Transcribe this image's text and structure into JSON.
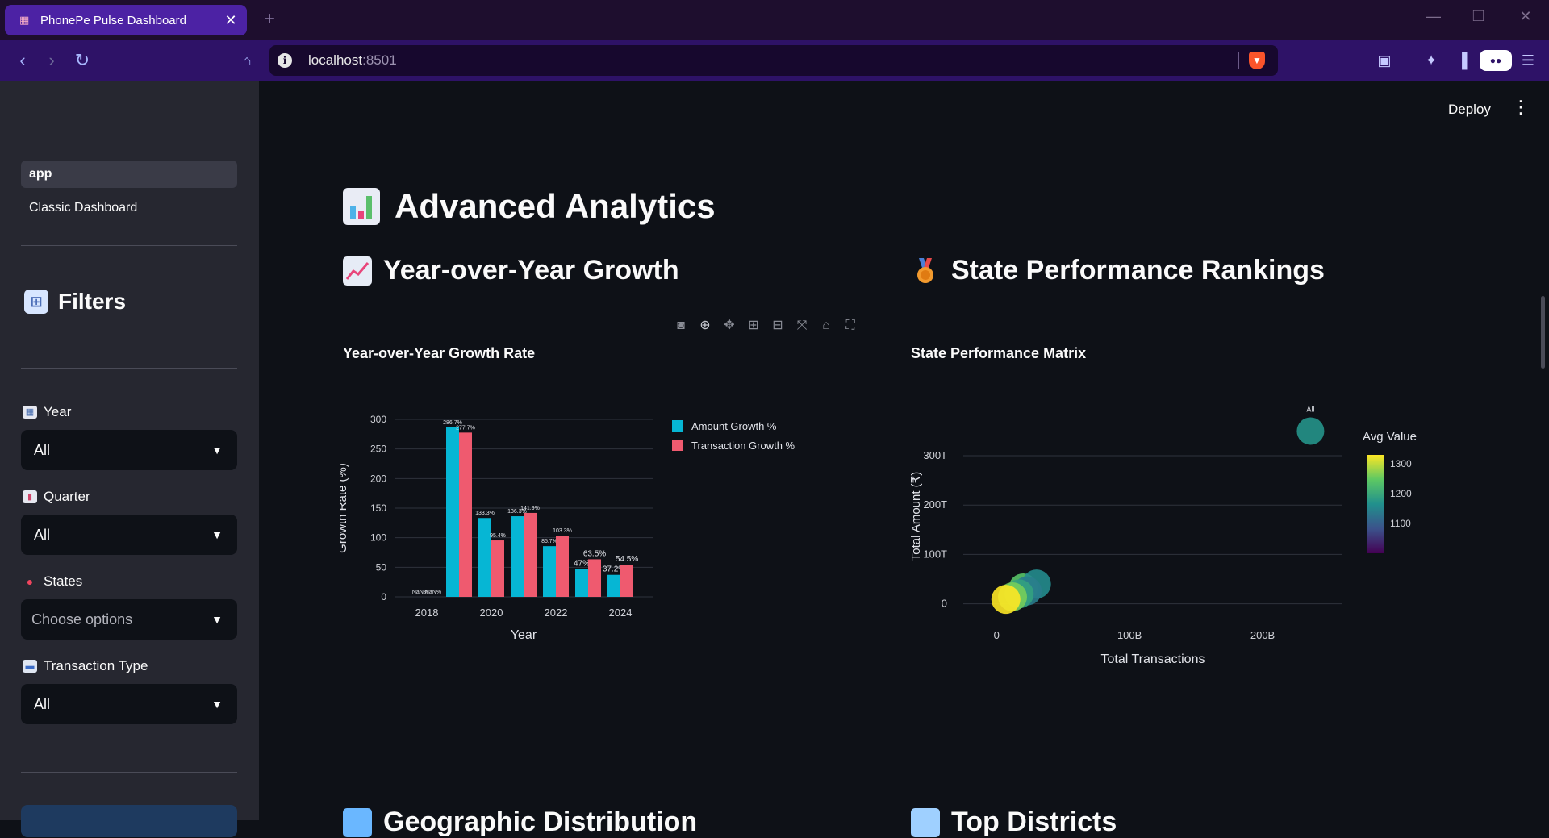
{
  "browser": {
    "tab_title": "PhonePe Pulse Dashboard",
    "url_host": "localhost",
    "url_port": ":8501",
    "new_tab_glyph": "+",
    "colors": {
      "titlebar": "#1e0e2e",
      "tab_active": "#4c22a4",
      "navbar": "#2e1267",
      "urlbar": "#17082e"
    }
  },
  "app_header": {
    "deploy_label": "Deploy"
  },
  "sidebar": {
    "nav": [
      {
        "label": "app",
        "active": true
      },
      {
        "label": "Classic Dashboard",
        "active": false
      }
    ],
    "filters_title": "Filters",
    "filters": [
      {
        "label": "Year",
        "value": "All",
        "icon": "calendar-icon"
      },
      {
        "label": "Quarter",
        "value": "All",
        "icon": "bar-chart-icon"
      },
      {
        "label": "States",
        "value": "Choose options",
        "icon": "pin-icon",
        "placeholder": true
      },
      {
        "label": "Transaction Type",
        "value": "All",
        "icon": "credit-card-icon"
      }
    ]
  },
  "main": {
    "page_title": "Advanced Analytics",
    "sections": [
      {
        "title": "Year-over-Year Growth",
        "icon": "chart-increasing-icon"
      },
      {
        "title": "State Performance Rankings",
        "icon": "medal-icon"
      },
      {
        "title": "Geographic Distribution",
        "icon": "map-icon"
      },
      {
        "title": "Top Districts",
        "icon": "cityscape-icon"
      }
    ]
  },
  "chart_data": [
    {
      "type": "bar",
      "title": "Year-over-Year Growth Rate",
      "xlabel": "Year",
      "ylabel": "Growth Rate (%)",
      "x_ticks": [
        2018,
        2020,
        2022,
        2024
      ],
      "y_ticks": [
        0,
        50,
        100,
        150,
        200,
        250,
        300
      ],
      "ylim": [
        0,
        300
      ],
      "categories": [
        2018,
        2019,
        2020,
        2021,
        2022,
        2023,
        2024
      ],
      "series": [
        {
          "name": "Amount Growth %",
          "color": "#06b6d4",
          "values": [
            null,
            286.7,
            133.3,
            136.3,
            85.7,
            47,
            37.2
          ],
          "labels": [
            "NaN%",
            "286.7%",
            "133.3%",
            "136.3%",
            "85.7%",
            "47%",
            "37.2%"
          ]
        },
        {
          "name": "Transaction Growth %",
          "color": "#ef5a6f",
          "values": [
            null,
            277.7,
            95.4,
            141.9,
            103.3,
            63.5,
            54.5
          ],
          "labels": [
            "NaN%",
            "277.7%",
            "95.4%",
            "141.9%",
            "103.3%",
            "63.5%",
            "54.5%"
          ]
        }
      ],
      "legend": "right"
    },
    {
      "type": "scatter",
      "title": "State Performance Matrix",
      "xlabel": "Total Transactions",
      "ylabel": "Total Amount (₹)",
      "x_ticks": [
        "0",
        "100B",
        "200B"
      ],
      "y_ticks": [
        "0",
        "100T",
        "200T",
        "300T"
      ],
      "xlim": [
        -25,
        260
      ],
      "ylim": [
        -35,
        390
      ],
      "colorbar": {
        "title": "Avg Value",
        "ticks": [
          1100,
          1200,
          1300
        ],
        "range": [
          1000,
          1330
        ]
      },
      "points": [
        {
          "label": "All",
          "x": 236,
          "y": 350,
          "value": 1170
        },
        {
          "label": "",
          "x": 7,
          "y": 9,
          "value": 1330
        },
        {
          "label": "",
          "x": 12,
          "y": 14,
          "value": 1260
        },
        {
          "label": "",
          "x": 17,
          "y": 20,
          "value": 1190
        },
        {
          "label": "",
          "x": 23,
          "y": 26,
          "value": 1140
        },
        {
          "label": "",
          "x": 30,
          "y": 40,
          "value": 1160
        },
        {
          "label": "",
          "x": 20,
          "y": 32,
          "value": 1240
        }
      ]
    }
  ]
}
